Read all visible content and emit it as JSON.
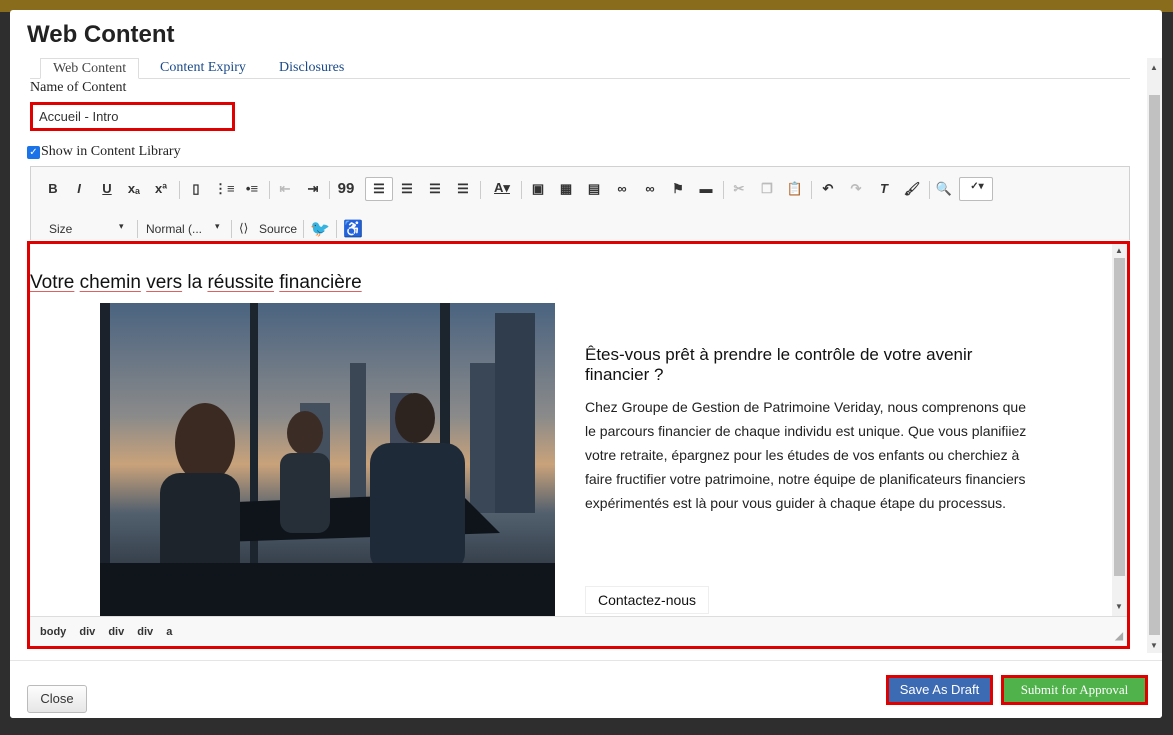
{
  "modal": {
    "title": "Web Content"
  },
  "tabs": [
    {
      "label": "Web Content",
      "active": true
    },
    {
      "label": "Content Expiry",
      "active": false
    },
    {
      "label": "Disclosures",
      "active": false
    }
  ],
  "form": {
    "name_label": "Name of Content",
    "name_value": "Accueil - Intro",
    "show_label": "Show in Content Library",
    "show_checked": true
  },
  "toolbar": {
    "bold": "B",
    "italic": "I",
    "underline": "U",
    "subscript": "xₐ",
    "superscript": "xª",
    "blockquote": "99",
    "size_label": "Size",
    "format_label": "Normal (...",
    "source_label": "Source"
  },
  "editor": {
    "heading": [
      "Votre",
      "chemin",
      "vers",
      "la",
      "réussite",
      "financière"
    ],
    "block_title": "Êtes-vous prêt à prendre le contrôle de votre avenir financier ?",
    "block_body": "Chez Groupe de Gestion de Patrimoine Veriday, nous comprenons que le parcours financier de chaque individu est unique. Que vous planifiiez votre retraite, épargnez pour les études de vos enfants ou cherchiez à faire fructifier votre patrimoine, notre équipe de planificateurs financiers expérimentés est là pour vous guider à chaque étape du processus.",
    "contact_label": "Contactez-nous",
    "path": [
      "body",
      "div",
      "div",
      "div",
      "a"
    ]
  },
  "footer": {
    "close_label": "Close",
    "draft_label": "Save As Draft",
    "submit_label": "Submit for Approval"
  },
  "colors": {
    "highlight": "#e00000",
    "draft": "#3d6bb3",
    "submit": "#4fb24a",
    "checkbox": "#1a73e8"
  }
}
